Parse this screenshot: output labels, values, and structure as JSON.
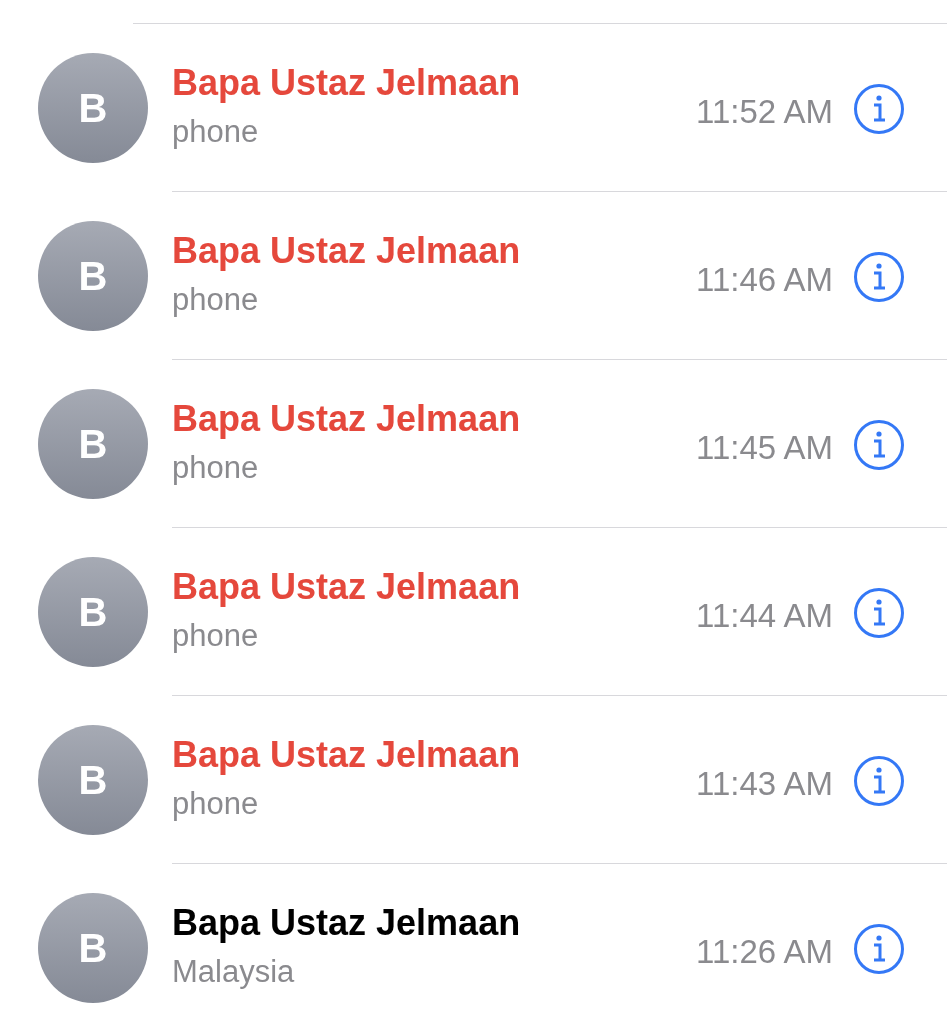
{
  "calls": [
    {
      "initial": "B",
      "name": "Bapa Ustaz Jelmaan",
      "detail": "phone",
      "time": "11:52 AM",
      "missed": true
    },
    {
      "initial": "B",
      "name": "Bapa Ustaz Jelmaan",
      "detail": "phone",
      "time": "11:46 AM",
      "missed": true
    },
    {
      "initial": "B",
      "name": "Bapa Ustaz Jelmaan",
      "detail": "phone",
      "time": "11:45 AM",
      "missed": true
    },
    {
      "initial": "B",
      "name": "Bapa Ustaz Jelmaan",
      "detail": "phone",
      "time": "11:44 AM",
      "missed": true
    },
    {
      "initial": "B",
      "name": "Bapa Ustaz Jelmaan",
      "detail": "phone",
      "time": "11:43 AM",
      "missed": true
    },
    {
      "initial": "B",
      "name": "Bapa Ustaz Jelmaan",
      "detail": "Malaysia",
      "time": "11:26 AM",
      "missed": false
    }
  ]
}
